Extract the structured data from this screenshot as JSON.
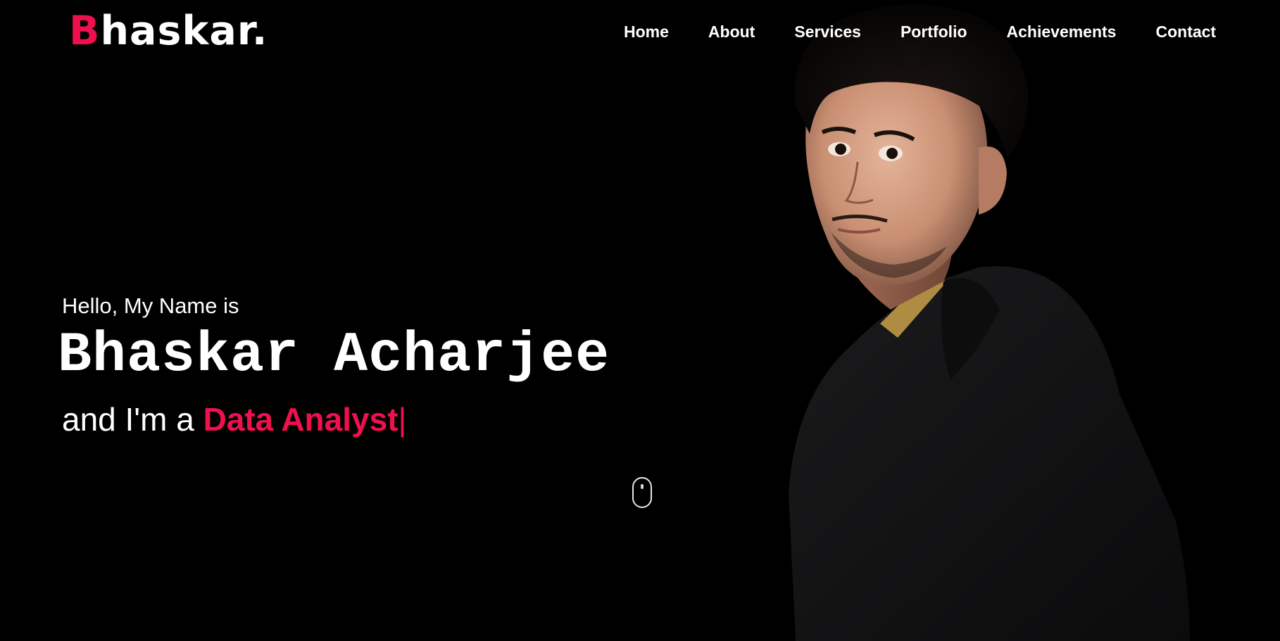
{
  "brand": {
    "logo_first": "B",
    "logo_rest": "haskar",
    "logo_dot": ".",
    "accent_color": "#f0104e"
  },
  "nav": {
    "items": [
      {
        "label": "Home"
      },
      {
        "label": "About"
      },
      {
        "label": "Services"
      },
      {
        "label": "Portfolio"
      },
      {
        "label": "Achievements"
      },
      {
        "label": "Contact"
      }
    ]
  },
  "hero": {
    "greeting": "Hello, My Name is",
    "name": "Bhaskar Acharjee",
    "role_prefix": "and I'm a ",
    "role_typed": "Data Analyst",
    "cursor": "|"
  },
  "portrait": {
    "description_icon": "portrait-photo"
  },
  "scroll_indicator": {
    "icon": "mouse-scroll-icon"
  }
}
